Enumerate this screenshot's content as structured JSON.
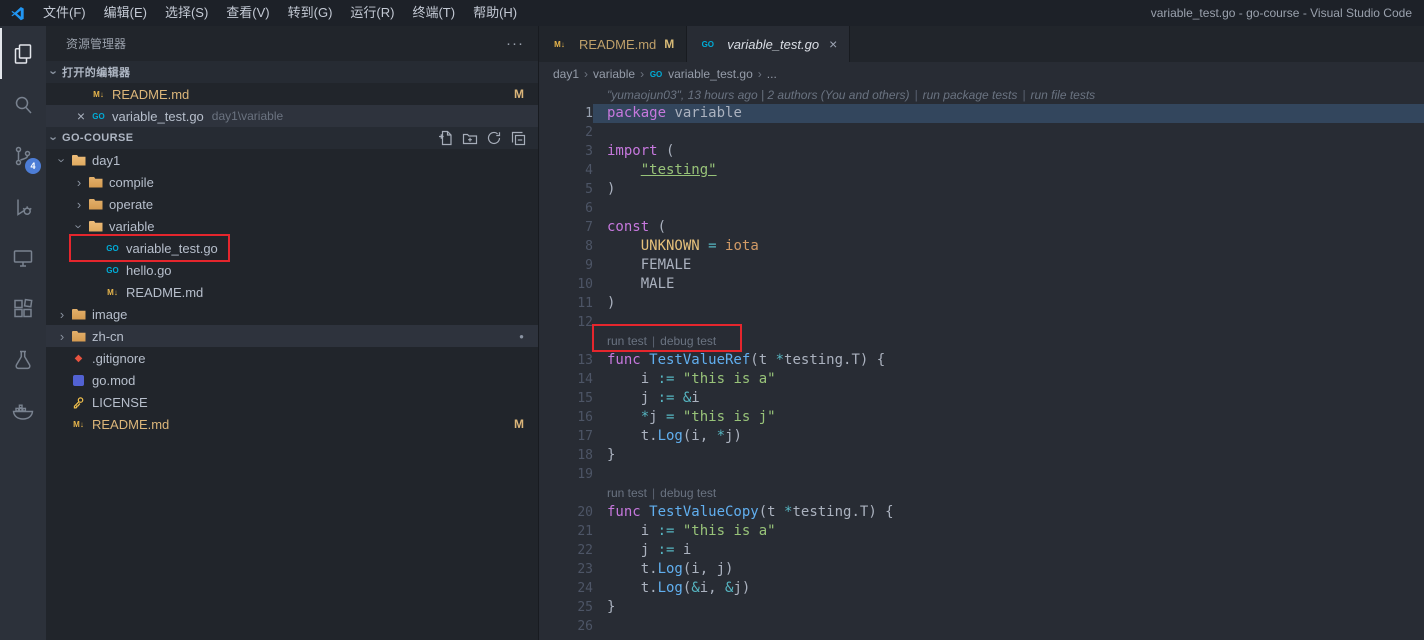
{
  "window": {
    "title": "variable_test.go - go-course - Visual Studio Code",
    "menus": [
      "文件(F)",
      "编辑(E)",
      "选择(S)",
      "查看(V)",
      "转到(G)",
      "运行(R)",
      "终端(T)",
      "帮助(H)"
    ]
  },
  "activity_bar": {
    "source_control_badge": "4"
  },
  "sidebar": {
    "title": "资源管理器",
    "more_actions": "···",
    "open_editors": {
      "label": "打开的编辑器",
      "items": [
        {
          "name": "README.md",
          "icon": "md",
          "badge": "M"
        },
        {
          "name": "variable_test.go",
          "icon": "go",
          "path": "day1\\variable",
          "active": true,
          "close": "×"
        }
      ]
    },
    "workspace": {
      "label": "GO-COURSE",
      "items": [
        {
          "label": "day1",
          "kind": "folder",
          "level": 0,
          "expanded": true
        },
        {
          "label": "compile",
          "kind": "folder",
          "level": 1
        },
        {
          "label": "operate",
          "kind": "folder",
          "level": 1
        },
        {
          "label": "variable",
          "kind": "folder",
          "level": 1,
          "expanded": true
        },
        {
          "label": "variable_test.go",
          "kind": "go",
          "level": 2
        },
        {
          "label": "hello.go",
          "kind": "go",
          "level": 2
        },
        {
          "label": "README.md",
          "kind": "md",
          "level": 2
        },
        {
          "label": "image",
          "kind": "folder",
          "level": 0
        },
        {
          "label": "zh-cn",
          "kind": "folder",
          "level": 0,
          "selected": true,
          "dot": "●"
        },
        {
          "label": ".gitignore",
          "kind": "git",
          "level": 0
        },
        {
          "label": "go.mod",
          "kind": "gomod",
          "level": 0
        },
        {
          "label": "LICENSE",
          "kind": "license",
          "level": 0
        },
        {
          "label": "README.md",
          "kind": "md",
          "level": 0,
          "badge": "M"
        }
      ]
    }
  },
  "editor": {
    "tabs": [
      {
        "label": "README.md",
        "icon": "md",
        "badge": "M",
        "active": false
      },
      {
        "label": "variable_test.go",
        "icon": "go",
        "close": "×",
        "active": true
      }
    ],
    "breadcrumb": {
      "items": [
        "day1",
        "variable",
        "variable_test.go",
        "..."
      ],
      "separator": "›"
    },
    "gitlens": {
      "blame": "\"yumaojun03\", 13 hours ago | 2 authors (You and others)",
      "separator": "|",
      "lens_package": "run package tests",
      "lens_file": "run file tests"
    },
    "codelens": {
      "run": "run test",
      "debug": "debug test",
      "separator": "|"
    },
    "code_lines": [
      {
        "n": 1,
        "hl": true,
        "t": [
          [
            "kw",
            "package"
          ],
          [
            "fg",
            " variable"
          ]
        ]
      },
      {
        "n": 2,
        "t": []
      },
      {
        "n": 3,
        "t": [
          [
            "kw",
            "import"
          ],
          [
            "fg",
            " ("
          ]
        ]
      },
      {
        "n": 4,
        "t": [
          [
            "fg",
            "    "
          ],
          [
            "strlink",
            "\"testing\""
          ]
        ]
      },
      {
        "n": 5,
        "t": [
          [
            "fg",
            ")"
          ]
        ]
      },
      {
        "n": 6,
        "t": []
      },
      {
        "n": 7,
        "t": [
          [
            "kw",
            "const"
          ],
          [
            "fg",
            " ("
          ]
        ]
      },
      {
        "n": 8,
        "t": [
          [
            "fg",
            "    "
          ],
          [
            "const",
            "UNKNOWN"
          ],
          [
            "op",
            " = "
          ],
          [
            "num",
            "iota"
          ]
        ]
      },
      {
        "n": 9,
        "t": [
          [
            "fg",
            "    FEMALE"
          ]
        ]
      },
      {
        "n": 10,
        "t": [
          [
            "fg",
            "    MALE"
          ]
        ]
      },
      {
        "n": 11,
        "t": [
          [
            "fg",
            ")"
          ]
        ]
      },
      {
        "n": 12,
        "t": []
      },
      {
        "lens": true
      },
      {
        "n": 13,
        "t": [
          [
            "kw",
            "func"
          ],
          [
            "fn",
            " TestValueRef"
          ],
          [
            "fg",
            "(t "
          ],
          [
            "op",
            "*"
          ],
          [
            "fg",
            "testing.T) {"
          ]
        ]
      },
      {
        "n": 14,
        "t": [
          [
            "fg",
            "    i "
          ],
          [
            "op",
            ":="
          ],
          [
            "str",
            " \"this is a\""
          ]
        ]
      },
      {
        "n": 15,
        "t": [
          [
            "fg",
            "    j "
          ],
          [
            "op",
            ":= &"
          ],
          [
            "fg",
            "i"
          ]
        ]
      },
      {
        "n": 16,
        "t": [
          [
            "op",
            "    *"
          ],
          [
            "fg",
            "j "
          ],
          [
            "op",
            "="
          ],
          [
            "str",
            " \"this is j\""
          ]
        ]
      },
      {
        "n": 17,
        "t": [
          [
            "fg",
            "    t."
          ],
          [
            "fn",
            "Log"
          ],
          [
            "fg",
            "(i, "
          ],
          [
            "op",
            "*"
          ],
          [
            "fg",
            "j)"
          ]
        ]
      },
      {
        "n": 18,
        "t": [
          [
            "fg",
            "}"
          ]
        ]
      },
      {
        "n": 19,
        "t": []
      },
      {
        "lens": true
      },
      {
        "n": 20,
        "t": [
          [
            "kw",
            "func"
          ],
          [
            "fn",
            " TestValueCopy"
          ],
          [
            "fg",
            "(t "
          ],
          [
            "op",
            "*"
          ],
          [
            "fg",
            "testing.T) {"
          ]
        ]
      },
      {
        "n": 21,
        "t": [
          [
            "fg",
            "    i "
          ],
          [
            "op",
            ":="
          ],
          [
            "str",
            " \"this is a\""
          ]
        ]
      },
      {
        "n": 22,
        "t": [
          [
            "fg",
            "    j "
          ],
          [
            "op",
            ":="
          ],
          [
            "fg",
            " i"
          ]
        ]
      },
      {
        "n": 23,
        "t": [
          [
            "fg",
            "    t."
          ],
          [
            "fn",
            "Log"
          ],
          [
            "fg",
            "(i, j)"
          ]
        ]
      },
      {
        "n": 24,
        "t": [
          [
            "fg",
            "    t."
          ],
          [
            "fn",
            "Log"
          ],
          [
            "fg",
            "("
          ],
          [
            "op",
            "&"
          ],
          [
            "fg",
            "i, "
          ],
          [
            "op",
            "&"
          ],
          [
            "fg",
            "j)"
          ]
        ]
      },
      {
        "n": 25,
        "t": [
          [
            "fg",
            "}"
          ]
        ]
      },
      {
        "n": 26,
        "t": []
      }
    ]
  },
  "annotations": {
    "color": "#e5262d",
    "boxes": [
      {
        "target": "sidebar variable_test.go item"
      },
      {
        "target": "codelens run test | debug test"
      }
    ]
  }
}
